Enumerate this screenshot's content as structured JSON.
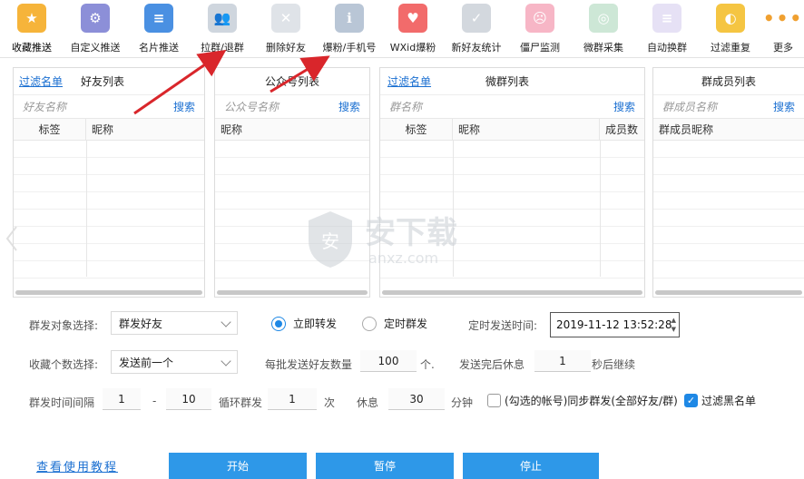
{
  "toolbar": {
    "items": [
      {
        "label": "收藏推送",
        "color": "#f6b43a",
        "glyph": "★"
      },
      {
        "label": "自定义推送",
        "color": "#8c8fd8",
        "glyph": "⚙"
      },
      {
        "label": "名片推送",
        "color": "#4a90e2",
        "glyph": "≡"
      },
      {
        "label": "拉群/退群",
        "color": "#cfd6de",
        "glyph": "👥"
      },
      {
        "label": "删除好友",
        "color": "#dfe3e8",
        "glyph": "✕"
      },
      {
        "label": "爆粉/手机号",
        "color": "#b9c6d6",
        "glyph": "ℹ"
      },
      {
        "label": "WXid爆粉",
        "color": "#f26b6b",
        "glyph": "♥"
      },
      {
        "label": "新好友统计",
        "color": "#d3d8de",
        "glyph": "✓"
      },
      {
        "label": "僵尸监测",
        "color": "#f7b6c6",
        "glyph": "☹"
      },
      {
        "label": "微群采集",
        "color": "#cde7d6",
        "glyph": "◎"
      },
      {
        "label": "自动换群",
        "color": "#e6e1f5",
        "glyph": "≡"
      },
      {
        "label": "过滤重复",
        "color": "#f5c542",
        "glyph": "◐"
      }
    ],
    "more_label": "更多"
  },
  "panels": {
    "friends": {
      "link": "过滤名单",
      "title": "好友列表",
      "placeholder": "好友名称",
      "search": "搜索",
      "col1": "标签",
      "col2": "昵称"
    },
    "official": {
      "title": "公众号列表",
      "placeholder": "公众号名称",
      "search": "搜索",
      "col1": "昵称"
    },
    "groups": {
      "link": "过滤名单",
      "title": "微群列表",
      "placeholder": "群名称",
      "search": "搜索",
      "col1": "标签",
      "col2": "昵称",
      "col3": "成员数"
    },
    "members": {
      "title": "群成员列表",
      "placeholder": "群成员名称",
      "search": "搜索",
      "col1": "群成员昵称"
    }
  },
  "controls": {
    "target_label": "群发对象选择:",
    "target_value": "群发好友",
    "radio_now": "立即转发",
    "radio_timed": "定时群发",
    "send_time_label": "定时发送时间:",
    "send_time_value": "2019-11-12 13:52:28",
    "collect_label": "收藏个数选择:",
    "collect_value": "发送前一个",
    "batch_label": "每批发送好友数量",
    "batch_value": "100",
    "batch_unit": "个.",
    "rest_label": "发送完后休息",
    "rest_value": "1",
    "rest_unit": "秒后继续",
    "interval_label": "群发时间间隔",
    "interval_from": "1",
    "interval_dash": "-",
    "interval_to": "10",
    "loop_label": "循环群发",
    "loop_value": "1",
    "loop_unit": "次",
    "pause_label": "休息",
    "pause_value": "30",
    "pause_unit": "分钟",
    "sync_label": "(勾选的帐号)同步群发(全部好友/群)",
    "blacklist_label": "过滤黑名单"
  },
  "footer": {
    "tutorial": "查看使用教程",
    "start": "开始",
    "pause": "暂停",
    "stop": "停止"
  },
  "watermark": {
    "text_cn": "安下载",
    "text_en": "anxz.com"
  },
  "colors": {
    "accent": "#2e98e8",
    "link": "#1a6fd1",
    "arrow": "#d9262b"
  }
}
